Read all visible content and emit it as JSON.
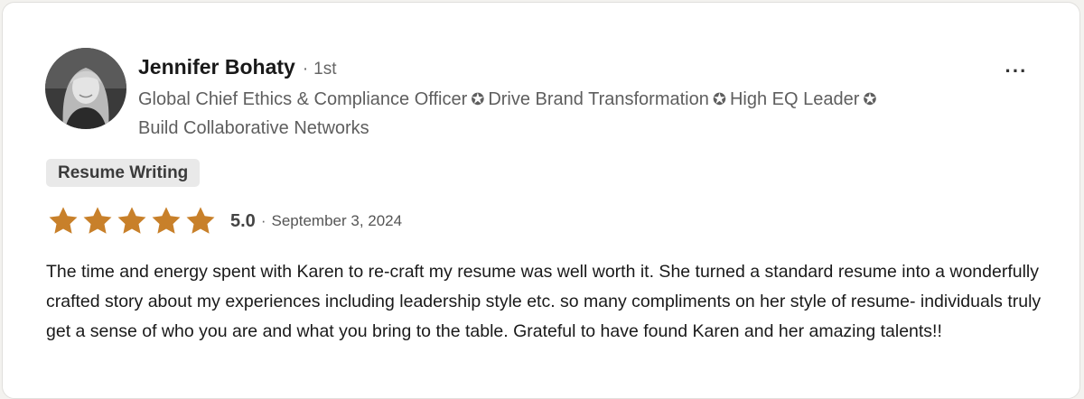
{
  "reviewer": {
    "name": "Jennifer Bohaty",
    "separator": "·",
    "connection_degree": "1st",
    "headline_parts": [
      "Global Chief Ethics & Compliance Officer",
      "Drive Brand Transformation",
      "High EQ Leader",
      "Build Collaborative Networks"
    ],
    "headline_separator_symbol": "✪"
  },
  "more_menu": {
    "label": "···",
    "icon": "more-horizontal-icon"
  },
  "service_tag": "Resume Writing",
  "rating": {
    "value": 5.0,
    "max": 5,
    "label": "5.0",
    "separator": "·",
    "date": "September 3, 2024",
    "star_color": "#c8802a"
  },
  "review_text": "The time and energy spent with Karen to re-craft my resume was well worth it. She turned a standard resume into a wonderfully crafted story about my experiences including leadership style etc. so many compliments on her style of resume- individuals truly get a sense of who you are and what you bring to the table. Grateful to have found Karen and her amazing talents!!"
}
